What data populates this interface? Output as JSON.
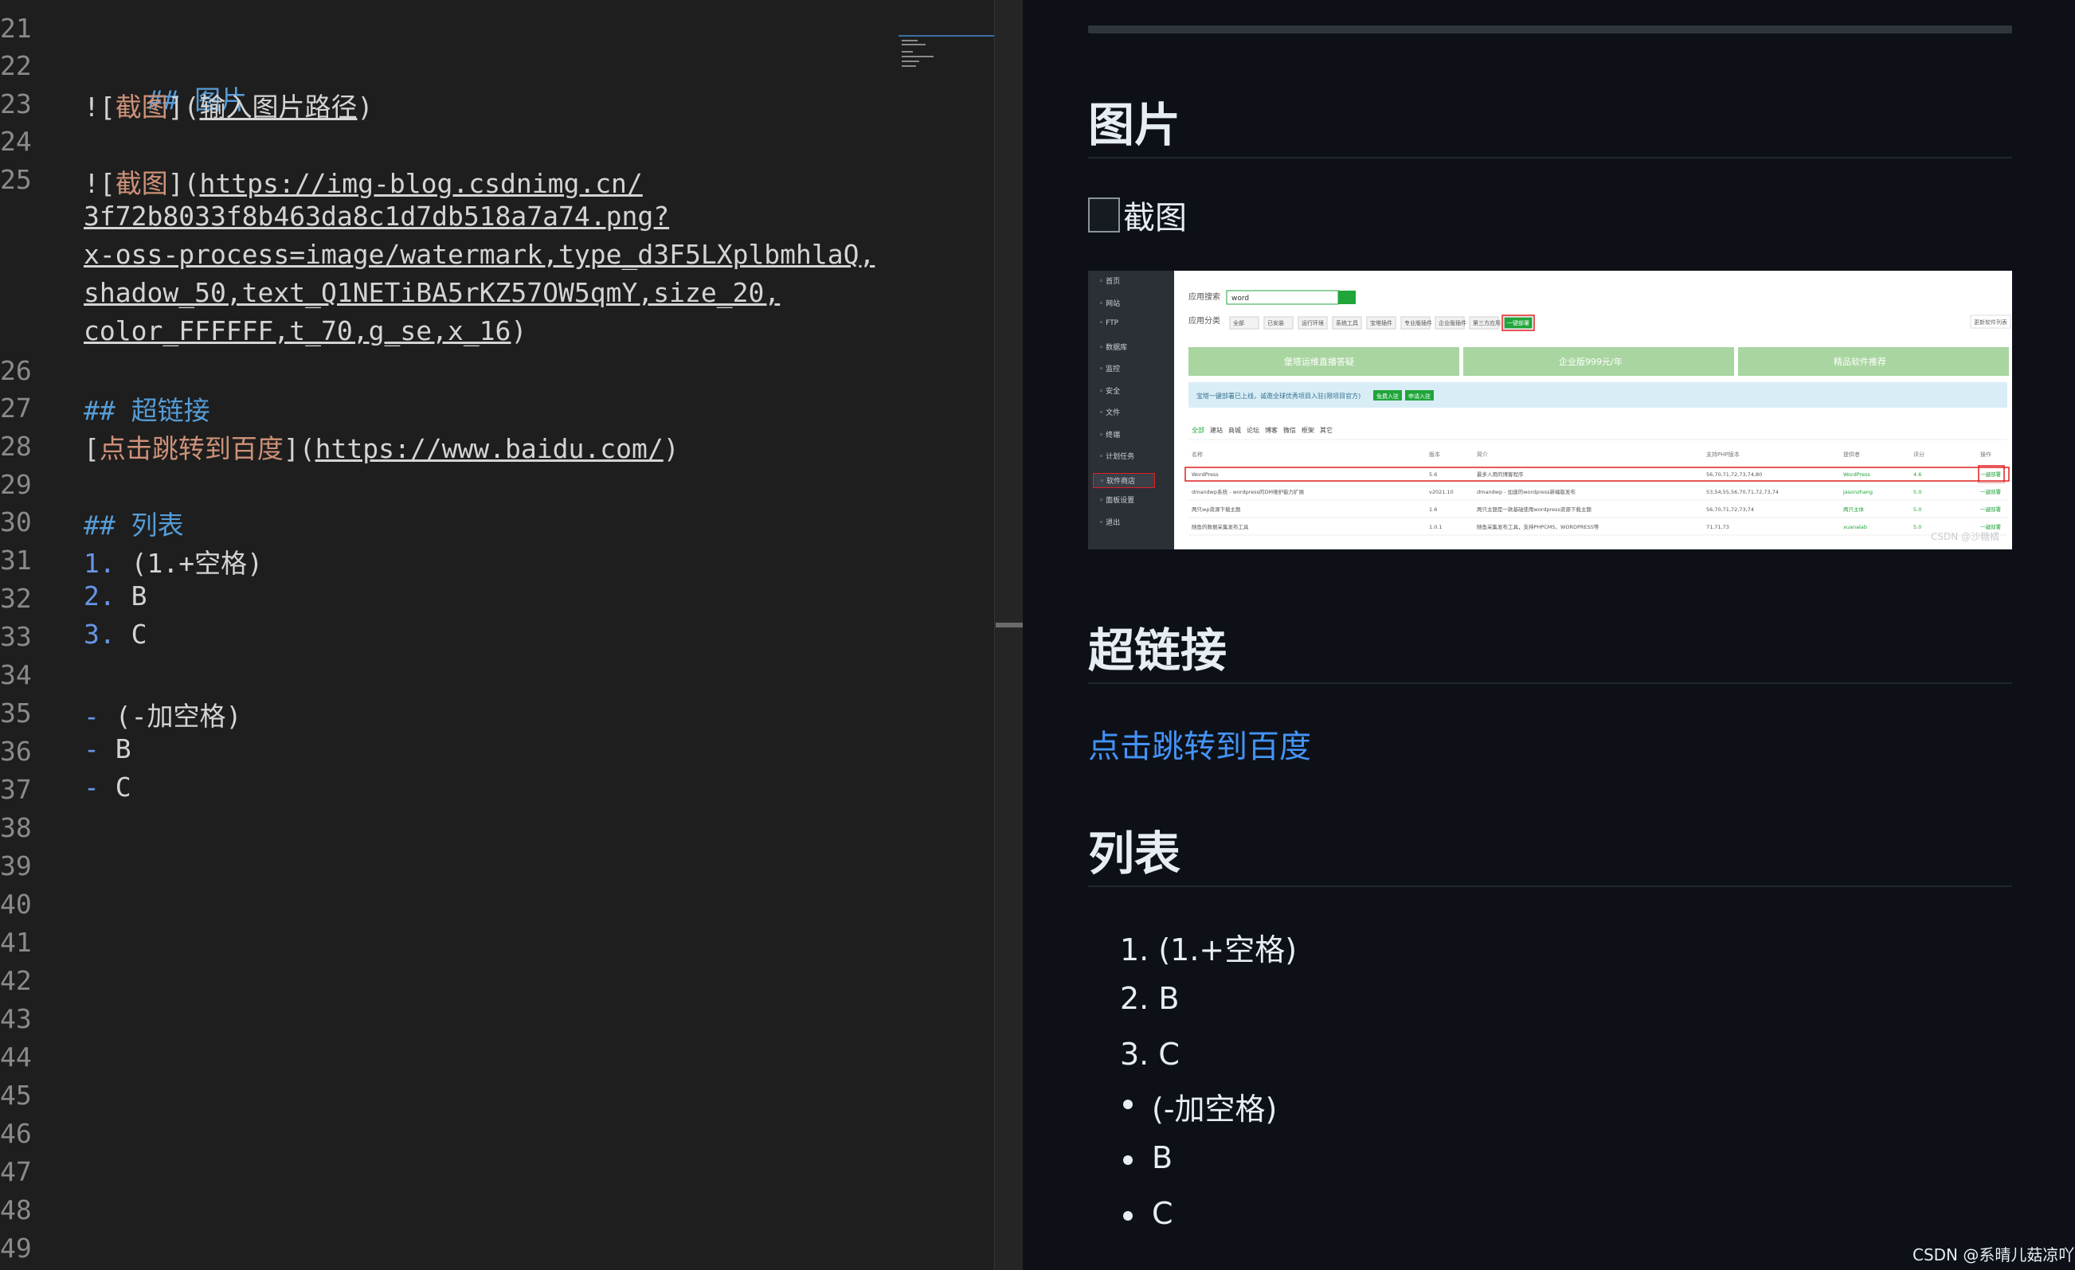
{
  "editor": {
    "line_numbers": [
      "21",
      "22",
      "23",
      "24",
      "25",
      "",
      "",
      "",
      "",
      "26",
      "27",
      "28",
      "29",
      "30",
      "31",
      "32",
      "33",
      "34",
      "35",
      "36",
      "37",
      "38",
      "39",
      "40",
      "41",
      "42",
      "43",
      "44",
      "45",
      "46",
      "47",
      "48",
      "49"
    ],
    "lines": {
      "l22_h": "## 图片",
      "l23_a": "![",
      "l23_alt": "截图",
      "l23_b": "](",
      "l23_url": "输入图片路径",
      "l23_c": ")",
      "l25_a": "![",
      "l25_alt": "截图",
      "l25_b": "](",
      "l25_url1": "https://img-blog.csdnimg.cn/",
      "l25_url2": "3f72b8033f8b463da8c1d7db518a7a74.png?",
      "l25_url3": "x-oss-process=image/watermark,type_d3F5LXplbmhlaQ,",
      "l25_url4": "shadow_50,text_Q1NETiBA5rKZ57OW5qmY,size_20,",
      "l25_url5": "color_FFFFFF,t_70,g_se,x_16",
      "l25_c": ")",
      "l27_h": "## 超链接",
      "l28_a": "[",
      "l28_text": "点击跳转到百度",
      "l28_b": "](",
      "l28_url": "https://www.baidu.com/",
      "l28_c": ")",
      "l30_h": "## 列表",
      "l31_n": "1.",
      "l31_t": " (1.+空格)",
      "l32_n": "2.",
      "l32_t": " B",
      "l33_n": "3.",
      "l33_t": " C",
      "l35_n": "-",
      "l35_t": " (-加空格)",
      "l36_n": "-",
      "l36_t": " B",
      "l37_n": "-",
      "l37_t": " C"
    }
  },
  "preview": {
    "section_image_title": "图片",
    "broken_image_alt": "截图",
    "section_link_title": "超链接",
    "link_text": "点击跳转到百度",
    "section_list_title": "列表",
    "ordered_items": [
      "1. (1.+空格)",
      "2. B",
      "3. C"
    ],
    "bullet_items": [
      "(-加空格)",
      "B",
      "C"
    ],
    "embedded_screenshot": {
      "sidebar": [
        "首页",
        "网站",
        "FTP",
        "数据库",
        "监控",
        "安全",
        "文件",
        "终端",
        "计划任务",
        "软件商店",
        "面板设置",
        "退出"
      ],
      "search_label": "应用搜索",
      "search_value": "word",
      "category_label": "应用分类",
      "categories": [
        "全部",
        "已安装",
        "运行环境",
        "系统工具",
        "宝塔插件",
        "专业版插件",
        "企业版插件",
        "第三方应用",
        "一键部署"
      ],
      "banners": [
        "堡塔运维直播答疑",
        "企业版999元/年",
        "精品软件推荐"
      ],
      "notice": "宝塔一键部署已上线，诚邀全球优秀项目入驻(限项目官方)",
      "notice_btn1": "免费入驻",
      "notice_btn2": "申请入驻",
      "tabs": [
        "全部",
        "建站",
        "商城",
        "论坛",
        "博客",
        "微信",
        "框架",
        "其它"
      ],
      "table_headers": [
        "名称",
        "版本",
        "简介",
        "支持PHP版本",
        "提供者",
        "评分",
        "操作"
      ],
      "rows": [
        {
          "name": "WordPress",
          "ver": "5.6",
          "desc": "最多人用的博客程序",
          "php": "56,70,71,72,73,74,80",
          "by": "WordPress",
          "score": "4.6",
          "op": "一键部署"
        },
        {
          "name": "dmandwp系统 - wordpress的DM维护能力扩展",
          "ver": "v2021.10",
          "desc": "dmandwp - 加速的wordpress新编版发布",
          "php": "53,54,55,56,70,71,72,73,74",
          "by": "jasonzhang",
          "score": "5.0",
          "op": "一键部署"
        },
        {
          "name": "两只wp资源下载主题",
          "ver": "1.6",
          "desc": "两只主题是一款基础使用wordpress资源下载主题",
          "php": "56,70,71,72,73,74",
          "by": "两只主体",
          "score": "5.0",
          "op": "一键部署"
        },
        {
          "name": "随鱼的数据采集发布工具",
          "ver": "1.0.1",
          "desc": "随鱼采集发布工具，支持PHPCMS、WORDPRESS等",
          "php": "71,71,73",
          "by": "xuanalab",
          "score": "5.0",
          "op": "一键部署"
        }
      ],
      "more_label": "更新软件列表",
      "watermark": "CSDN @沙糖橘"
    }
  },
  "watermark": "CSDN @系晴儿菇凉吖",
  "colors": {
    "editor_bg": "#1e1e1e",
    "preview_bg": "#0d1117",
    "heading_blue": "#569cd6",
    "alt_orange": "#ce9178",
    "link_blue": "#4493f8",
    "bt_green": "#20a53a"
  }
}
